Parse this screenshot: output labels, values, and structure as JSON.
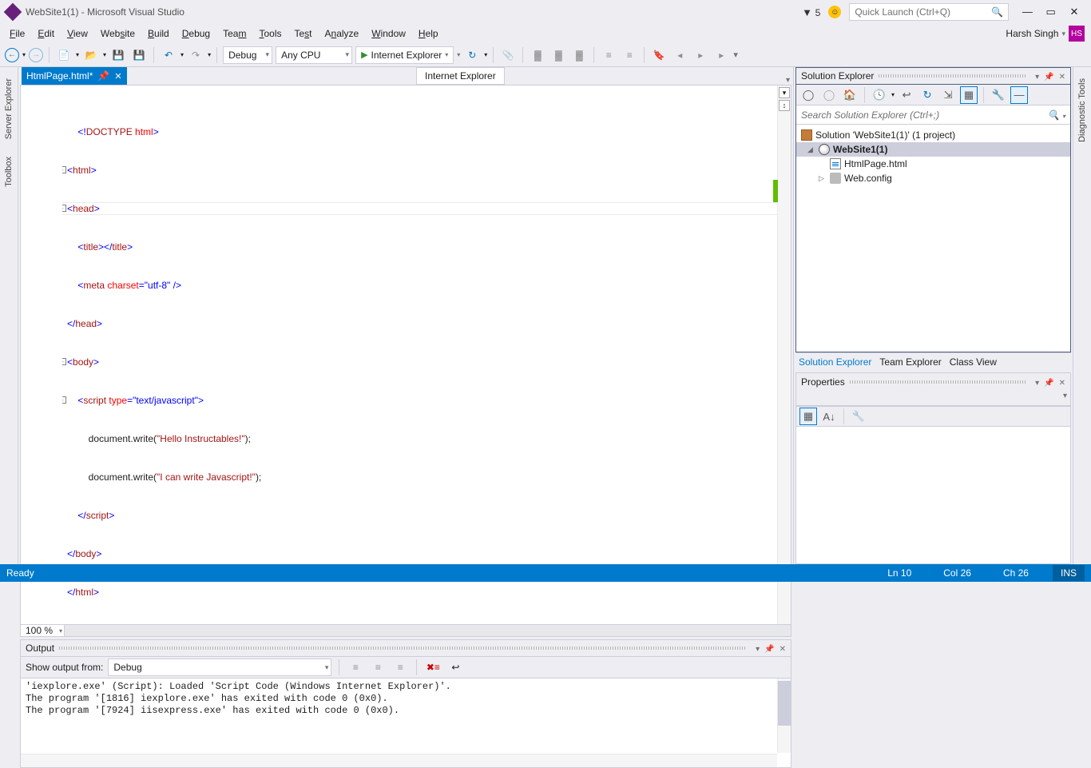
{
  "title": "WebSite1(1) - Microsoft Visual Studio",
  "notifications": "5",
  "quick_launch_placeholder": "Quick Launch (Ctrl+Q)",
  "user_name": "Harsh Singh",
  "user_initials": "HS",
  "menu": [
    "File",
    "Edit",
    "View",
    "Website",
    "Build",
    "Debug",
    "Team",
    "Tools",
    "Test",
    "Analyze",
    "Window",
    "Help"
  ],
  "menu_underline_idx": [
    0,
    0,
    0,
    4,
    0,
    0,
    3,
    0,
    4,
    0,
    0,
    0
  ],
  "config": "Debug",
  "platform": "Any CPU",
  "run_target": "Internet Explorer",
  "active_tab": "HtmlPage.html*",
  "browser_popup": "Internet Explorer",
  "zoom": "100 %",
  "code": {
    "l1": {
      "pre": "    ",
      "a": "<!",
      "b": "DOCTYPE",
      "c": " ",
      "d": "html",
      "e": ">"
    },
    "l2": {
      "a": "<",
      "b": "html",
      "c": ">"
    },
    "l3": {
      "a": "<",
      "b": "head",
      "c": ">"
    },
    "l4": {
      "pre": "    ",
      "a": "<",
      "b": "title",
      "c": "></",
      "d": "title",
      "e": ">"
    },
    "l5": {
      "pre": "    ",
      "a": "<",
      "b": "meta",
      "c": " ",
      "d": "charset",
      "e": "=\"utf-8\"",
      "f": " />"
    },
    "l6": {
      "a": "</",
      "b": "head",
      "c": ">"
    },
    "l7": {
      "a": "<",
      "b": "body",
      "c": ">"
    },
    "l8": {
      "pre": "    ",
      "a": "<",
      "b": "script",
      "c": " ",
      "d": "type",
      "e": "=\"text/javascript\"",
      "f": ">"
    },
    "l9": {
      "pre": "        ",
      "t": "document.write(",
      "s": "\"Hello Instructables!\"",
      "end": ");"
    },
    "l10": {
      "pre": "        ",
      "t": "document.write(",
      "s": "\"I can write Javascript!\"",
      "end": ");"
    },
    "l11": {
      "pre": "    ",
      "a": "</",
      "b": "script",
      "c": ">"
    },
    "l12": {
      "a": "</",
      "b": "body",
      "c": ">"
    },
    "l13": {
      "a": "</",
      "b": "html",
      "c": ">"
    }
  },
  "output": {
    "title": "Output",
    "show_label": "Show output from:",
    "source": "Debug",
    "lines": "'iexplore.exe' (Script): Loaded 'Script Code (Windows Internet Explorer)'.\nThe program '[1816] iexplore.exe' has exited with code 0 (0x0).\nThe program '[7924] iisexpress.exe' has exited with code 0 (0x0).\n"
  },
  "sln": {
    "title": "Solution Explorer",
    "search_placeholder": "Search Solution Explorer (Ctrl+;)",
    "root": "Solution 'WebSite1(1)' (1 project)",
    "project": "WebSite1(1)",
    "file1": "HtmlPage.html",
    "file2": "Web.config",
    "tabs": [
      "Solution Explorer",
      "Team Explorer",
      "Class View"
    ]
  },
  "props": {
    "title": "Properties"
  },
  "right_collapsed": "Diagnostic Tools",
  "left_tabs": [
    "Server Explorer",
    "Toolbox"
  ],
  "status": {
    "ready": "Ready",
    "ln": "Ln 10",
    "col": "Col 26",
    "ch": "Ch 26",
    "ins": "INS"
  }
}
